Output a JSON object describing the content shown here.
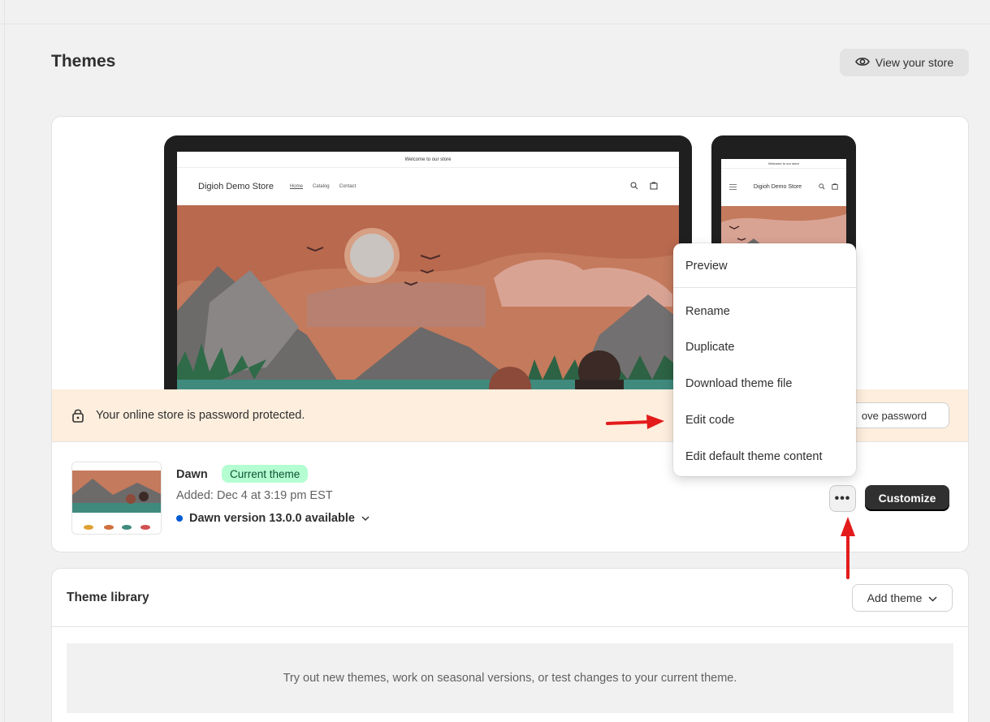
{
  "page": {
    "title": "Themes",
    "view_store_label": "View your store"
  },
  "current_theme_preview": {
    "desktop": {
      "announcement": "Welcome to our store",
      "store_name": "Digioh Demo Store",
      "nav": [
        "Home",
        "Catalog",
        "Contact"
      ]
    },
    "mobile": {
      "announcement": "Welcome to our store",
      "store_name": "Digioh Demo Store"
    }
  },
  "password_banner": {
    "message": "Your online store is password protected.",
    "button_label": "ove password"
  },
  "current_theme": {
    "name": "Dawn",
    "badge": "Current theme",
    "added": "Added: Dec 4 at 3:19 pm EST",
    "version_notice": "Dawn version 13.0.0 available",
    "more_label": "•••",
    "customize_label": "Customize"
  },
  "actions_menu": {
    "items": [
      "Preview",
      "Rename",
      "Duplicate",
      "Download theme file",
      "Edit code",
      "Edit default theme content"
    ]
  },
  "theme_library": {
    "title": "Theme library",
    "add_theme_label": "Add theme",
    "empty_message": "Try out new themes, work on seasonal versions, or test changes to your current theme."
  },
  "colors": {
    "accent_badge_bg": "#b4fed2",
    "banner_bg": "#fdeedd",
    "primary_button": "#303030",
    "annotation_arrow": "#e31b1b",
    "version_dot": "#005bd3"
  }
}
